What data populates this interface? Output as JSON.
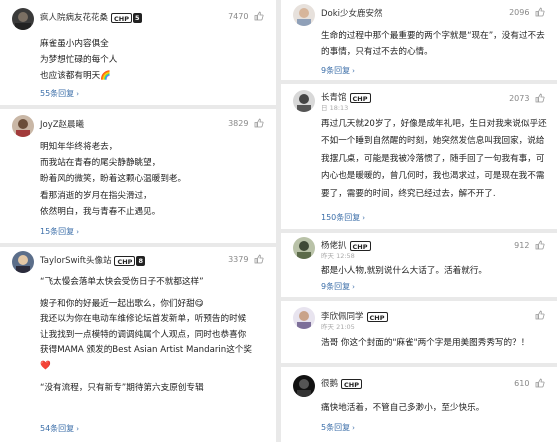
{
  "left": [
    {
      "username": "疯人院病友花花桑",
      "badges": [
        "CHP",
        "5"
      ],
      "timestamp": "",
      "likes": "7470",
      "lines": [
        "麻雀虽小内容俱全",
        "为梦想忙碌的每个人",
        "也应该都有明天🌈"
      ],
      "replies": "55条回复"
    },
    {
      "username": "JoyZ赵晨曦",
      "badges": [],
      "timestamp": "",
      "likes": "3829",
      "lines": [
        "明知年华终将老去，",
        "而我站在青春的尾尖静静眺望，",
        "盼着风的微笑，盼着这颗心温暖到老。",
        "看那消逝的岁月在指尖滑过，",
        "依然明白，我与青春不止遇见。"
      ],
      "replies": "15条回复"
    },
    {
      "username": "TaylorSwift头像站",
      "badges": [
        "CHP",
        "8"
      ],
      "timestamp": "",
      "likes": "3379",
      "lines": [
        "“飞太慢会落单太快会受伤日子不就都这样”",
        "",
        "嫂子和你的好最近一起出歌么，你们好甜😋",
        "我还以为你在电动车维修论坛首发新单，听预告的时候",
        "让我找到一点模特的调调纯属个人观点，同时也恭喜你",
        "获得MAMA 颁发的Best Asian Artist Mandarin这个奖",
        "❤️",
        "",
        "“没有流程，只有新专”期待第六支原创专辑"
      ],
      "replies": "54条回复"
    }
  ],
  "right": [
    {
      "username": "Doki少女鹿安然",
      "badges": [],
      "timestamp": "",
      "likes": "2096",
      "lines": [
        "生命的过程中那个最重要的两个字就是“现在”，没有过不去的事情，只有过不去的心情。"
      ],
      "replies": "9条回复"
    },
    {
      "username": "长青馆",
      "badges": [
        "CHP"
      ],
      "timestamp": "日 18:13",
      "likes": "2073",
      "lines": [
        "再过几天就20岁了，好像是成年礼吧，生日对我来说似乎还不如一个睡到自然醒的时刻，她突然发信息叫我回家，说给我摆几桌，可能是我被冷落惯了，随手回了一句我有事，可内心也是暖暖的，曾几何时，我也渴求过，可是现在我不需要了，需要的时间，终究已经过去，解不开了."
      ],
      "replies": "150条回复"
    },
    {
      "username": "杨佬扒",
      "badges": [
        "CHP"
      ],
      "timestamp": "昨天 12:58",
      "likes": "912",
      "lines": [
        "都是小人物,就别说什么大话了。活着就行。"
      ],
      "replies": "9条回复"
    },
    {
      "username": "李欣佩同学",
      "badges": [
        "CHP"
      ],
      "timestamp": "昨天 21:05",
      "likes": "",
      "lines": [
        "浩哥 你这个封面的\"麻雀\"两个字是用美图秀秀写的？！"
      ],
      "replies": ""
    },
    {
      "username": "很鹅",
      "badges": [
        "CHP"
      ],
      "timestamp": "",
      "likes": "610",
      "lines": [
        "痛快地活着，不管自己多渺小，至少快乐。"
      ],
      "replies": "5条回复"
    }
  ],
  "colors": {
    "link": "#3b6ea8",
    "muted": "#888888",
    "text": "#222222",
    "background": "#e9e9e9"
  }
}
